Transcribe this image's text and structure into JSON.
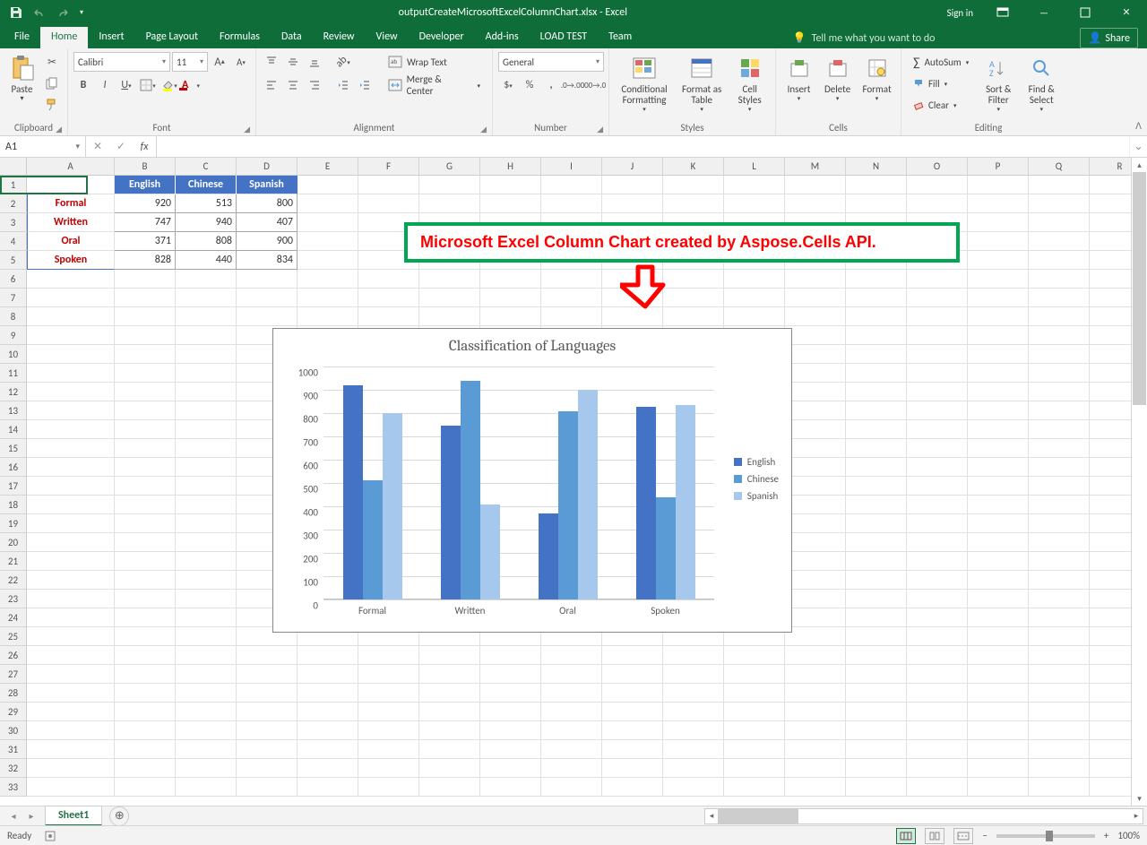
{
  "title_bar": {
    "filename": "outputCreateMicrosoftExcelColumnChart.xlsx - Excel",
    "signin": "Sign in"
  },
  "tabs": {
    "file": "File",
    "home": "Home",
    "insert": "Insert",
    "page_layout": "Page Layout",
    "formulas": "Formulas",
    "data": "Data",
    "review": "Review",
    "view": "View",
    "developer": "Developer",
    "addins": "Add-ins",
    "load_test": "LOAD TEST",
    "team": "Team",
    "tell_me": "Tell me what you want to do",
    "share": "Share"
  },
  "ribbon": {
    "clipboard": {
      "label": "Clipboard",
      "paste": "Paste"
    },
    "font": {
      "label": "Font",
      "family": "Calibri",
      "size": "11"
    },
    "alignment": {
      "label": "Alignment",
      "wrap": "Wrap Text",
      "merge": "Merge & Center"
    },
    "number": {
      "label": "Number",
      "format": "General"
    },
    "styles": {
      "label": "Styles",
      "cond": "Conditional Formatting",
      "table": "Format as Table",
      "cell": "Cell Styles"
    },
    "cells": {
      "label": "Cells",
      "insert": "Insert",
      "delete": "Delete",
      "format": "Format"
    },
    "editing": {
      "label": "Editing",
      "autosum": "AutoSum",
      "fill": "Fill",
      "clear": "Clear",
      "sort": "Sort & Filter",
      "find": "Find & Select"
    }
  },
  "name_box": "A1",
  "formula": "",
  "columns": [
    "A",
    "B",
    "C",
    "D",
    "E",
    "F",
    "G",
    "H",
    "I",
    "J",
    "K",
    "L",
    "M",
    "N",
    "O",
    "P",
    "Q",
    "R"
  ],
  "rows": [
    "1",
    "2",
    "3",
    "4",
    "5",
    "6",
    "7",
    "8",
    "9",
    "10",
    "11",
    "12",
    "13",
    "14",
    "15",
    "16",
    "17",
    "18",
    "19",
    "20",
    "21",
    "22",
    "23",
    "24",
    "25",
    "26",
    "27",
    "28",
    "29",
    "30",
    "31",
    "32",
    "33"
  ],
  "table": {
    "headers": [
      "English",
      "Chinese",
      "Spanish"
    ],
    "row_labels": [
      "Formal",
      "Written",
      "Oral",
      "Spoken"
    ],
    "data": [
      [
        920,
        513,
        800
      ],
      [
        747,
        940,
        407
      ],
      [
        371,
        808,
        900
      ],
      [
        828,
        440,
        834
      ]
    ]
  },
  "annotation": "Microsoft Excel Column Chart created by Aspose.Cells API.",
  "chart_data": {
    "type": "bar",
    "title": "Classification of Languages",
    "categories": [
      "Formal",
      "Written",
      "Oral",
      "Spoken"
    ],
    "series": [
      {
        "name": "English",
        "values": [
          920,
          747,
          371,
          828
        ],
        "color": "#4472c4"
      },
      {
        "name": "Chinese",
        "values": [
          513,
          940,
          808,
          440
        ],
        "color": "#5b9bd5"
      },
      {
        "name": "Spanish",
        "values": [
          800,
          407,
          900,
          834
        ],
        "color": "#a5c8ec"
      }
    ],
    "ylim": [
      0,
      1000
    ],
    "ystep": 100,
    "xlabel": "",
    "ylabel": ""
  },
  "sheet_tab": "Sheet1",
  "status": {
    "ready": "Ready",
    "zoom": "100%"
  }
}
